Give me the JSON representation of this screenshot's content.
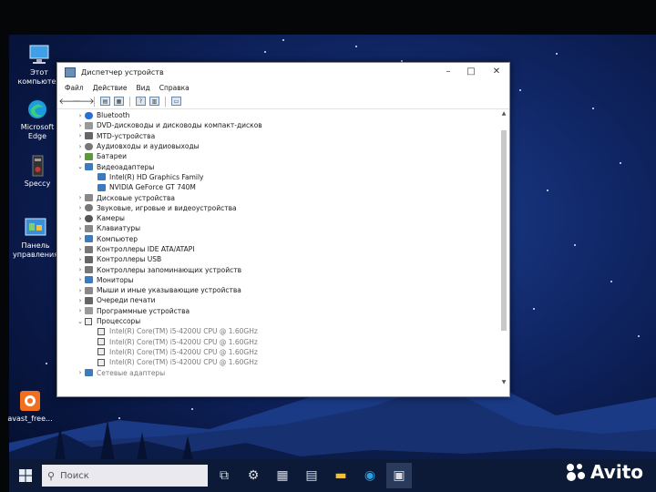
{
  "desktop": {
    "icons": [
      {
        "label": "Этот компьютер",
        "icon": "computer-icon"
      },
      {
        "label": "Microsoft Edge",
        "icon": "edge-icon"
      },
      {
        "label": "Speccy",
        "icon": "speccy-icon"
      },
      {
        "label": "Панель управления",
        "icon": "control-panel-icon"
      },
      {
        "label": "avast_free...",
        "icon": "avast-icon"
      }
    ]
  },
  "window": {
    "title": "Диспетчер устройств",
    "menu": [
      "Файл",
      "Действие",
      "Вид",
      "Справка"
    ],
    "tree": [
      {
        "label": "Bluetooth",
        "expanded": false
      },
      {
        "label": "DVD-дисководы и дисководы компакт-дисков",
        "expanded": false
      },
      {
        "label": "MTD-устройства",
        "expanded": false
      },
      {
        "label": "Аудиовходы и аудиовыходы",
        "expanded": false
      },
      {
        "label": "Батареи",
        "expanded": false
      },
      {
        "label": "Видеоадаптеры",
        "expanded": true,
        "children": [
          "Intel(R) HD Graphics Family",
          "NVIDIA GeForce GT 740M"
        ]
      },
      {
        "label": "Дисковые устройства",
        "expanded": false
      },
      {
        "label": "Звуковые, игровые и видеоустройства",
        "expanded": false
      },
      {
        "label": "Камеры",
        "expanded": false
      },
      {
        "label": "Клавиатуры",
        "expanded": false
      },
      {
        "label": "Компьютер",
        "expanded": false
      },
      {
        "label": "Контроллеры IDE ATA/ATAPI",
        "expanded": false
      },
      {
        "label": "Контроллеры USB",
        "expanded": false
      },
      {
        "label": "Контроллеры запоминающих устройств",
        "expanded": false
      },
      {
        "label": "Мониторы",
        "expanded": false
      },
      {
        "label": "Мыши и иные указывающие устройства",
        "expanded": false
      },
      {
        "label": "Очереди печати",
        "expanded": false
      },
      {
        "label": "Программные устройства",
        "expanded": false
      },
      {
        "label": "Процессоры",
        "expanded": true,
        "children": [
          "Intel(R) Core(TM) i5-4200U CPU @ 1.60GHz",
          "Intel(R) Core(TM) i5-4200U CPU @ 1.60GHz",
          "Intel(R) Core(TM) i5-4200U CPU @ 1.60GHz",
          "Intel(R) Core(TM) i5-4200U CPU @ 1.60GHz"
        ]
      },
      {
        "label": "Сетевые адаптеры",
        "expanded": false
      }
    ]
  },
  "taskbar": {
    "search_placeholder": "Поиск"
  },
  "watermark": "Avito"
}
